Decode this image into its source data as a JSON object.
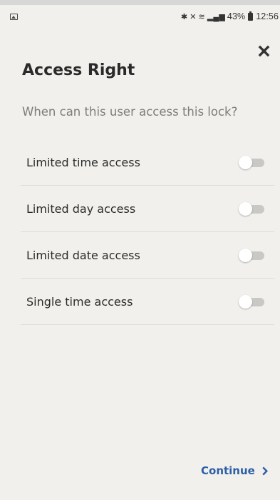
{
  "status_bar": {
    "icons": [
      "gallery-icon",
      "bluetooth-icon",
      "mute-icon",
      "wifi-icon",
      "signal-icon",
      "battery-icon"
    ],
    "battery": "43%",
    "time": "12:56"
  },
  "header": {
    "title": "Access Right",
    "close_icon": "close-icon"
  },
  "question": "When can this user access this lock?",
  "options": [
    {
      "label": "Limited time access",
      "enabled": false
    },
    {
      "label": "Limited day access",
      "enabled": false
    },
    {
      "label": "Limited date access",
      "enabled": false
    },
    {
      "label": "Single time access",
      "enabled": false
    }
  ],
  "footer": {
    "continue_label": "Continue",
    "continue_icon": "chevron-right-icon"
  },
  "colors": {
    "background": "#f1f0ec",
    "accent": "#2d5fa8",
    "muted_text": "#7d7d7d",
    "toggle_off_track": "#c9c8c4"
  }
}
